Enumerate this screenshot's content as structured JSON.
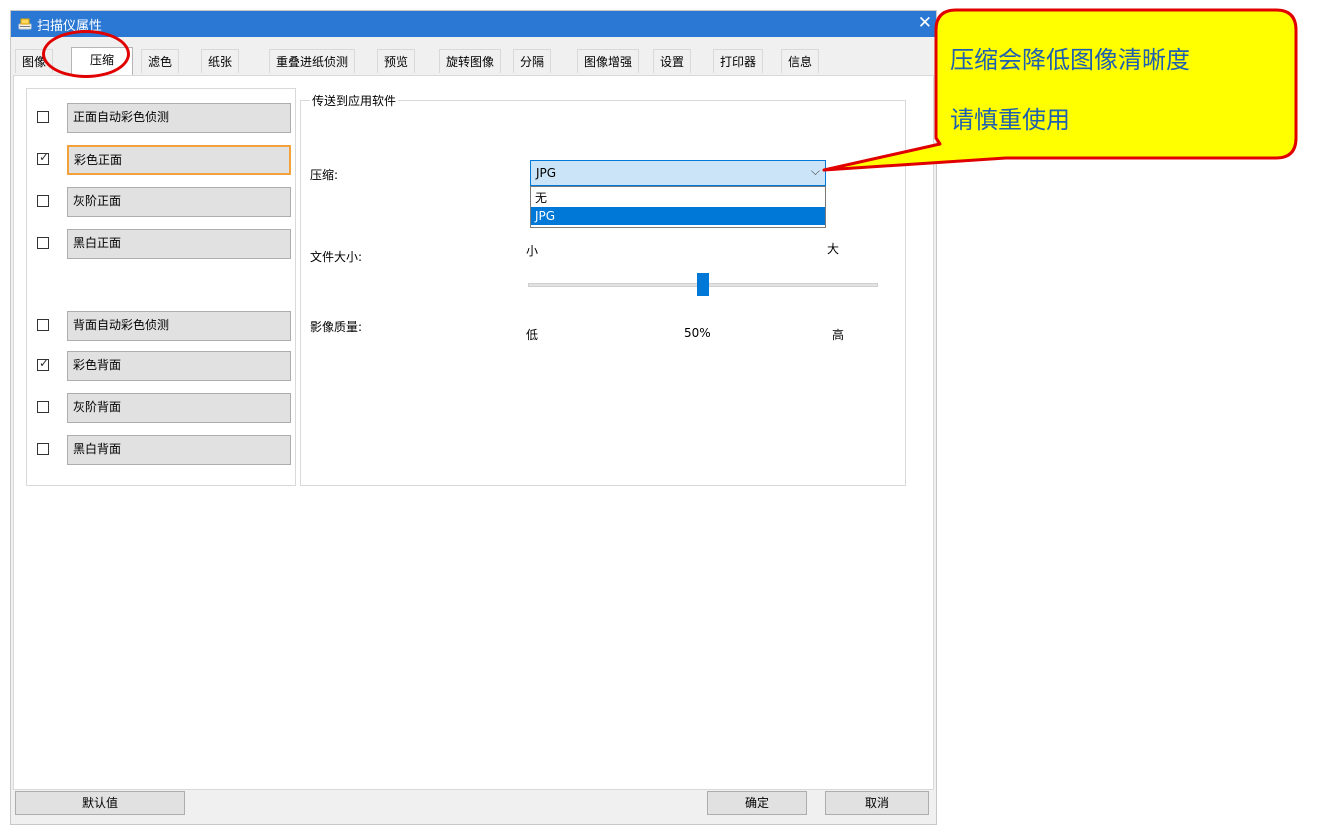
{
  "window": {
    "title": "扫描仪属性",
    "close_glyph": "✕",
    "title_icon": "scanner-icon"
  },
  "tabs": [
    {
      "label": "图像"
    },
    {
      "label": "压缩",
      "active": true
    },
    {
      "label": "滤色"
    },
    {
      "label": "纸张"
    },
    {
      "label": "重叠进纸侦测"
    },
    {
      "label": "预览"
    },
    {
      "label": "旋转图像"
    },
    {
      "label": "分隔"
    },
    {
      "label": "图像增强"
    },
    {
      "label": "设置"
    },
    {
      "label": "打印器"
    },
    {
      "label": "信息"
    }
  ],
  "image_options": [
    {
      "label": "正面自动彩色侦测",
      "checked": false
    },
    {
      "label": "彩色正面",
      "checked": true,
      "focused": true
    },
    {
      "label": "灰阶正面",
      "checked": false
    },
    {
      "label": "黑白正面",
      "checked": false
    },
    {
      "label": "背面自动彩色侦测",
      "checked": false
    },
    {
      "label": "彩色背面",
      "checked": true
    },
    {
      "label": "灰阶背面",
      "checked": false
    },
    {
      "label": "黑白背面",
      "checked": false
    }
  ],
  "send_group": {
    "title": "传送到应用软件",
    "compression_label": "压缩:",
    "compression_value": "JPG",
    "compression_options": [
      "无",
      "JPG"
    ],
    "selected_option": "JPG",
    "file_size_label": "文件大小:",
    "size_small": "小",
    "size_large": "大",
    "slider_level": 0.5,
    "quality_label": "影像质量:",
    "quality_low": "低",
    "quality_value": "50%",
    "quality_high": "高"
  },
  "buttons": {
    "default": "默认值",
    "ok": "确定",
    "cancel": "取消"
  },
  "callout": {
    "line1": "压缩会降低图像清晰度",
    "line2": "请慎重使用",
    "fill_color": "#ffff00",
    "border_color": "#e00000",
    "text_color": "#1f5fb0"
  },
  "colors": {
    "titlebar": "#2b78d4",
    "accent": "#0078d7",
    "focus": "#f3a13a",
    "highlight": "#e00000"
  }
}
